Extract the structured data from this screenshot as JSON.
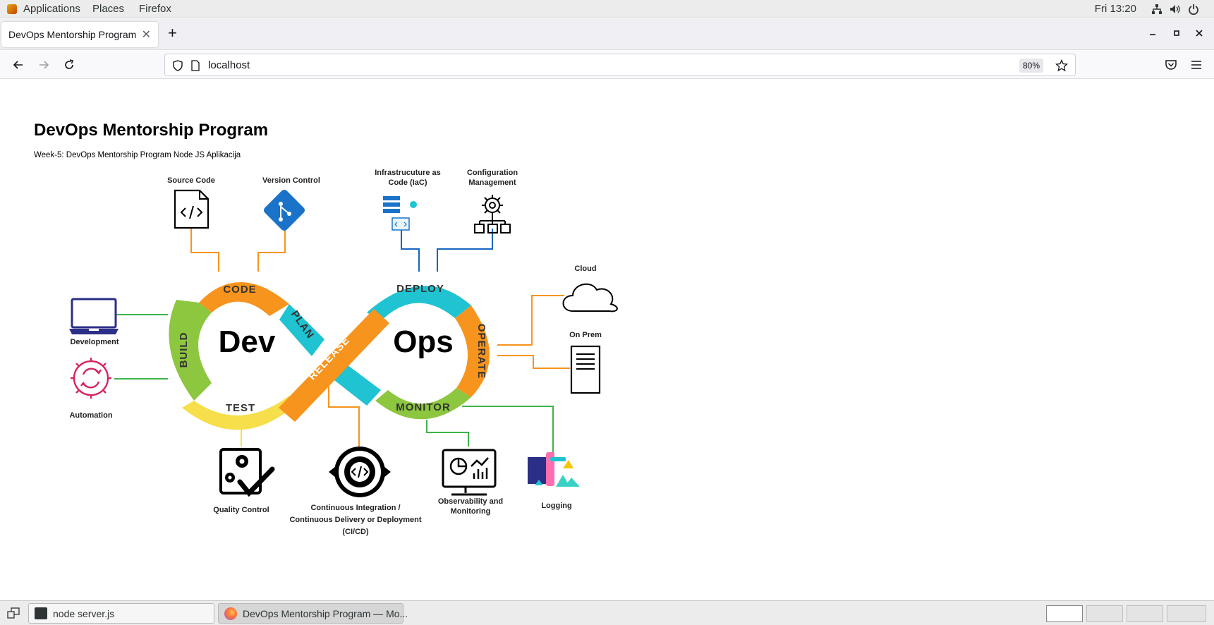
{
  "topbar": {
    "applications": "Applications",
    "places": "Places",
    "firefox": "Firefox",
    "clock": "Fri 13:20",
    "tray_icons": [
      "network-icon",
      "volume-icon",
      "power-icon"
    ]
  },
  "browser": {
    "tab_title": "DevOps Mentorship Program",
    "new_tab": "+",
    "url": "localhost",
    "zoom": "80%"
  },
  "page": {
    "title": "DevOps Mentorship Program",
    "subtitle": "Week-5: DevOps Mentorship Program Node JS Aplikacija"
  },
  "diagram": {
    "dev_label": "Dev",
    "ops_label": "Ops",
    "segments": {
      "code": "CODE",
      "plan": "PLAN",
      "build": "BUILD",
      "test": "TEST",
      "release": "RELEASE",
      "deploy": "DEPLOY",
      "operate": "OPERATE",
      "monitor": "MONITOR"
    },
    "labels": {
      "source_code": "Source Code",
      "version_control": "Version Control",
      "iac_line1": "Infrastrucuture as",
      "iac_line2": "Code (IaC)",
      "config_line1": "Configuration",
      "config_line2": "Management",
      "cloud": "Cloud",
      "on_prem": "On Prem",
      "development": "Development",
      "automation": "Automation",
      "quality_control": "Quality Control",
      "cicd_line1": "Continuous Integration /",
      "cicd_line2": "Continuous Delivery or Deployment",
      "cicd_line3": "(CI/CD)",
      "observability_line1": "Observability and",
      "observability_line2": "Monitoring",
      "logging": "Logging"
    },
    "colors": {
      "orange": "#f7941d",
      "teal": "#1fc3d2",
      "green": "#8dc63f",
      "yellow": "#f7df4b",
      "blue": "#1a73c8",
      "purple": "#2b2f87",
      "pink": "#d6245e",
      "line_green": "#3db54a",
      "line_blue": "#1565c0"
    }
  },
  "taskbar": {
    "task1": "node server.js",
    "task2": "DevOps Mentorship Program — Mo..."
  }
}
